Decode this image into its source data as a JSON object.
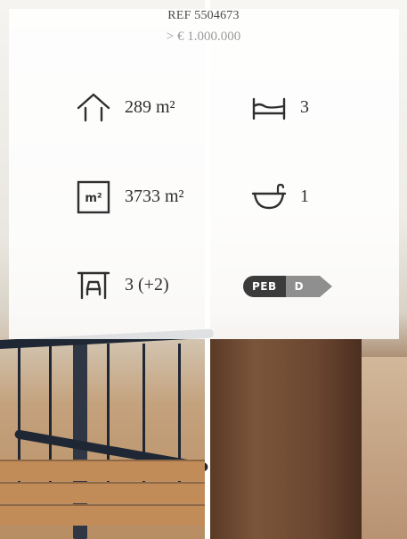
{
  "listing": {
    "ref_text": "REF 5504673",
    "price_text": "> € 1.000.000"
  },
  "features": {
    "living_area": {
      "icon": "house-icon",
      "value": "289 m²"
    },
    "bedrooms": {
      "icon": "bed-icon",
      "value": "3"
    },
    "land_area": {
      "icon": "land-area-icon",
      "badge_text": "m²",
      "value": "3733 m²"
    },
    "bathrooms": {
      "icon": "bathtub-icon",
      "value": "1"
    },
    "garage": {
      "icon": "garage-car-icon",
      "value": "3 (+2)"
    },
    "energy": {
      "icon": "peb-badge-icon",
      "label": "PEB",
      "rating": "D"
    }
  },
  "colors": {
    "text_dark": "#2f2f2f",
    "text_muted": "#9b9b9b",
    "peb_dark": "#3b3b3b",
    "peb_grey": "#8f8f8f"
  }
}
